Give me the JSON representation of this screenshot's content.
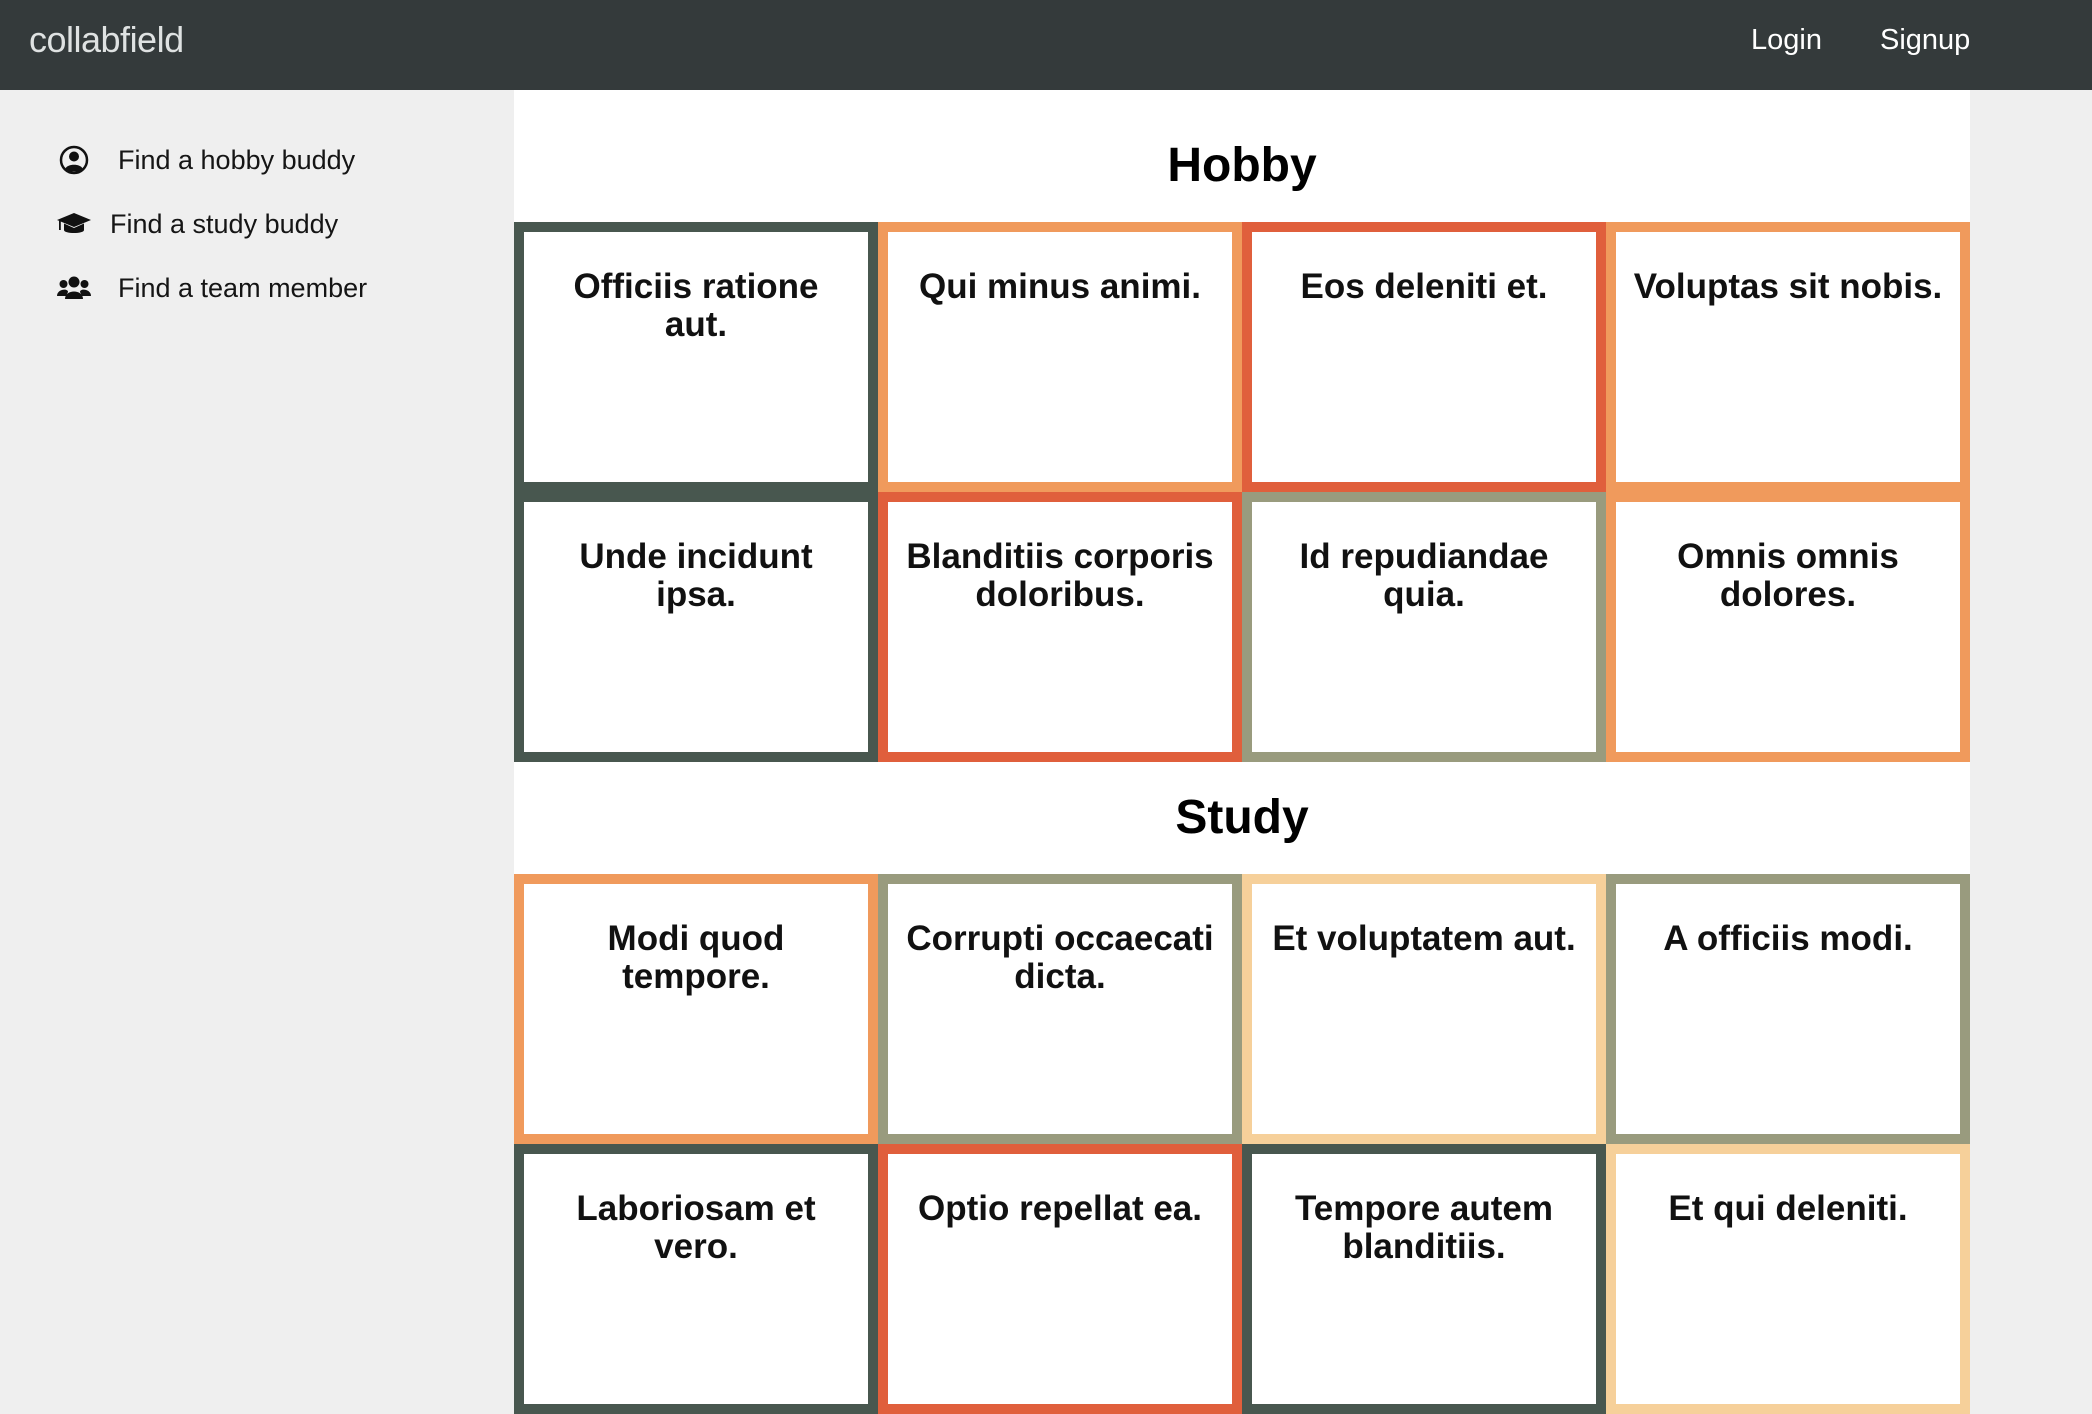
{
  "navbar": {
    "brand": "collabfield",
    "login": "Login",
    "signup": "Signup"
  },
  "sidebar": {
    "items": [
      {
        "label": "Find a hobby buddy",
        "icon": "user-circle-icon"
      },
      {
        "label": "Find a study buddy",
        "icon": "graduation-cap-icon"
      },
      {
        "label": "Find a team member",
        "icon": "users-icon"
      }
    ]
  },
  "colors": {
    "navbar": "#343a3b",
    "dark_green": "#48574f",
    "orange": "#f09a5c",
    "red_orange": "#e05f3c",
    "sage": "#999b7e",
    "peach": "#f6d09a"
  },
  "hobby": {
    "title": "Hobby",
    "cards": [
      {
        "title": "Officiis ratione aut.",
        "color": "#48574f"
      },
      {
        "title": "Qui minus animi.",
        "color": "#f09a5c"
      },
      {
        "title": "Eos deleniti et.",
        "color": "#e05f3c"
      },
      {
        "title": "Voluptas sit nobis.",
        "color": "#f09a5c"
      },
      {
        "title": "Unde incidunt ipsa.",
        "color": "#48574f"
      },
      {
        "title": "Blanditiis corporis doloribus.",
        "color": "#e05f3c"
      },
      {
        "title": "Id repudiandae quia.",
        "color": "#999b7e"
      },
      {
        "title": "Omnis omnis dolores.",
        "color": "#f09a5c"
      }
    ]
  },
  "study": {
    "title": "Study",
    "cards": [
      {
        "title": "Modi quod tempore.",
        "color": "#f09a5c"
      },
      {
        "title": "Corrupti occaecati dicta.",
        "color": "#999b7e"
      },
      {
        "title": "Et voluptatem aut.",
        "color": "#f6d09a"
      },
      {
        "title": "A officiis modi.",
        "color": "#999b7e"
      },
      {
        "title": "Laboriosam et vero.",
        "color": "#48574f"
      },
      {
        "title": "Optio repellat ea.",
        "color": "#e05f3c"
      },
      {
        "title": "Tempore autem blanditiis.",
        "color": "#48574f"
      },
      {
        "title": "Et qui deleniti.",
        "color": "#f6d09a"
      }
    ]
  }
}
